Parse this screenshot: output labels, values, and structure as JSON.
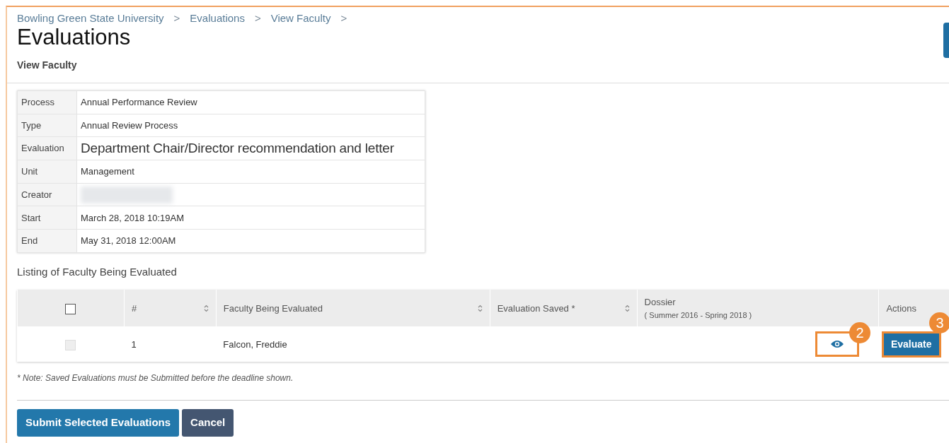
{
  "breadcrumb": [
    "Bowling Green State University",
    "Evaluations",
    "View Faculty"
  ],
  "breadcrumb_separator": ">",
  "title": "Evaluations",
  "subtitle": "View Faculty",
  "details": [
    {
      "label": "Process",
      "value": "Annual Performance Review"
    },
    {
      "label": "Type",
      "value": "Annual Review Process"
    },
    {
      "label": "Evaluation",
      "value": "Department Chair/Director recommendation and letter",
      "kind": "large"
    },
    {
      "label": "Unit",
      "value": "Management"
    },
    {
      "label": "Creator",
      "kind": "redacted"
    },
    {
      "label": "Start",
      "value": "March 28, 2018 10:19AM"
    },
    {
      "label": "End",
      "value": "May 31, 2018 12:00AM"
    }
  ],
  "listing_title": "Listing of Faculty Being Evaluated",
  "table": {
    "select_all": {
      "checked": false
    },
    "columns": [
      {
        "label": "#",
        "sortable": true
      },
      {
        "label": "Faculty Being Evaluated",
        "sortable": true
      },
      {
        "label": "Evaluation Saved *",
        "sortable": true
      },
      {
        "label": "Dossier",
        "sublabel": "( Summer 2016 - Spring 2018 )",
        "sortable": false
      },
      {
        "label": "Actions",
        "sortable": false
      }
    ],
    "rows": [
      {
        "checked": false,
        "disabled": true,
        "number": "1",
        "faculty": "Falcon, Freddie",
        "view_callout": "2",
        "action": "Evaluate",
        "action_callout": "3"
      }
    ]
  },
  "note": "* Note: Saved Evaluations must be Submitted before the deadline shown.",
  "buttons": [
    {
      "label": "Submit Selected Evaluations",
      "kind": "primary"
    },
    {
      "label": "Cancel",
      "kind": "secondary"
    }
  ]
}
